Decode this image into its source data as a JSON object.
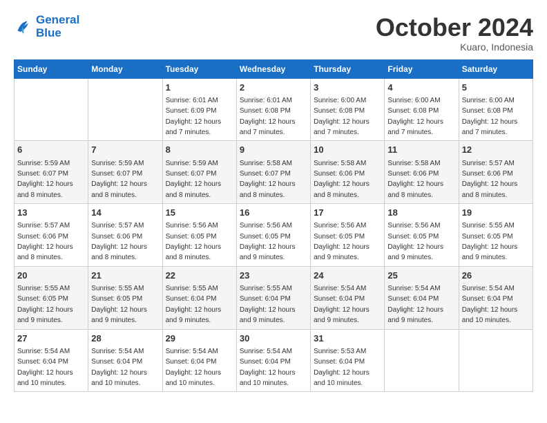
{
  "header": {
    "logo_line1": "General",
    "logo_line2": "Blue",
    "month": "October 2024",
    "location": "Kuaro, Indonesia"
  },
  "days_of_week": [
    "Sunday",
    "Monday",
    "Tuesday",
    "Wednesday",
    "Thursday",
    "Friday",
    "Saturday"
  ],
  "weeks": [
    [
      {
        "day": "",
        "sunrise": "",
        "sunset": "",
        "daylight": ""
      },
      {
        "day": "",
        "sunrise": "",
        "sunset": "",
        "daylight": ""
      },
      {
        "day": "1",
        "sunrise": "Sunrise: 6:01 AM",
        "sunset": "Sunset: 6:09 PM",
        "daylight": "Daylight: 12 hours and 7 minutes."
      },
      {
        "day": "2",
        "sunrise": "Sunrise: 6:01 AM",
        "sunset": "Sunset: 6:08 PM",
        "daylight": "Daylight: 12 hours and 7 minutes."
      },
      {
        "day": "3",
        "sunrise": "Sunrise: 6:00 AM",
        "sunset": "Sunset: 6:08 PM",
        "daylight": "Daylight: 12 hours and 7 minutes."
      },
      {
        "day": "4",
        "sunrise": "Sunrise: 6:00 AM",
        "sunset": "Sunset: 6:08 PM",
        "daylight": "Daylight: 12 hours and 7 minutes."
      },
      {
        "day": "5",
        "sunrise": "Sunrise: 6:00 AM",
        "sunset": "Sunset: 6:08 PM",
        "daylight": "Daylight: 12 hours and 7 minutes."
      }
    ],
    [
      {
        "day": "6",
        "sunrise": "Sunrise: 5:59 AM",
        "sunset": "Sunset: 6:07 PM",
        "daylight": "Daylight: 12 hours and 8 minutes."
      },
      {
        "day": "7",
        "sunrise": "Sunrise: 5:59 AM",
        "sunset": "Sunset: 6:07 PM",
        "daylight": "Daylight: 12 hours and 8 minutes."
      },
      {
        "day": "8",
        "sunrise": "Sunrise: 5:59 AM",
        "sunset": "Sunset: 6:07 PM",
        "daylight": "Daylight: 12 hours and 8 minutes."
      },
      {
        "day": "9",
        "sunrise": "Sunrise: 5:58 AM",
        "sunset": "Sunset: 6:07 PM",
        "daylight": "Daylight: 12 hours and 8 minutes."
      },
      {
        "day": "10",
        "sunrise": "Sunrise: 5:58 AM",
        "sunset": "Sunset: 6:06 PM",
        "daylight": "Daylight: 12 hours and 8 minutes."
      },
      {
        "day": "11",
        "sunrise": "Sunrise: 5:58 AM",
        "sunset": "Sunset: 6:06 PM",
        "daylight": "Daylight: 12 hours and 8 minutes."
      },
      {
        "day": "12",
        "sunrise": "Sunrise: 5:57 AM",
        "sunset": "Sunset: 6:06 PM",
        "daylight": "Daylight: 12 hours and 8 minutes."
      }
    ],
    [
      {
        "day": "13",
        "sunrise": "Sunrise: 5:57 AM",
        "sunset": "Sunset: 6:06 PM",
        "daylight": "Daylight: 12 hours and 8 minutes."
      },
      {
        "day": "14",
        "sunrise": "Sunrise: 5:57 AM",
        "sunset": "Sunset: 6:06 PM",
        "daylight": "Daylight: 12 hours and 8 minutes."
      },
      {
        "day": "15",
        "sunrise": "Sunrise: 5:56 AM",
        "sunset": "Sunset: 6:05 PM",
        "daylight": "Daylight: 12 hours and 8 minutes."
      },
      {
        "day": "16",
        "sunrise": "Sunrise: 5:56 AM",
        "sunset": "Sunset: 6:05 PM",
        "daylight": "Daylight: 12 hours and 9 minutes."
      },
      {
        "day": "17",
        "sunrise": "Sunrise: 5:56 AM",
        "sunset": "Sunset: 6:05 PM",
        "daylight": "Daylight: 12 hours and 9 minutes."
      },
      {
        "day": "18",
        "sunrise": "Sunrise: 5:56 AM",
        "sunset": "Sunset: 6:05 PM",
        "daylight": "Daylight: 12 hours and 9 minutes."
      },
      {
        "day": "19",
        "sunrise": "Sunrise: 5:55 AM",
        "sunset": "Sunset: 6:05 PM",
        "daylight": "Daylight: 12 hours and 9 minutes."
      }
    ],
    [
      {
        "day": "20",
        "sunrise": "Sunrise: 5:55 AM",
        "sunset": "Sunset: 6:05 PM",
        "daylight": "Daylight: 12 hours and 9 minutes."
      },
      {
        "day": "21",
        "sunrise": "Sunrise: 5:55 AM",
        "sunset": "Sunset: 6:05 PM",
        "daylight": "Daylight: 12 hours and 9 minutes."
      },
      {
        "day": "22",
        "sunrise": "Sunrise: 5:55 AM",
        "sunset": "Sunset: 6:04 PM",
        "daylight": "Daylight: 12 hours and 9 minutes."
      },
      {
        "day": "23",
        "sunrise": "Sunrise: 5:55 AM",
        "sunset": "Sunset: 6:04 PM",
        "daylight": "Daylight: 12 hours and 9 minutes."
      },
      {
        "day": "24",
        "sunrise": "Sunrise: 5:54 AM",
        "sunset": "Sunset: 6:04 PM",
        "daylight": "Daylight: 12 hours and 9 minutes."
      },
      {
        "day": "25",
        "sunrise": "Sunrise: 5:54 AM",
        "sunset": "Sunset: 6:04 PM",
        "daylight": "Daylight: 12 hours and 9 minutes."
      },
      {
        "day": "26",
        "sunrise": "Sunrise: 5:54 AM",
        "sunset": "Sunset: 6:04 PM",
        "daylight": "Daylight: 12 hours and 10 minutes."
      }
    ],
    [
      {
        "day": "27",
        "sunrise": "Sunrise: 5:54 AM",
        "sunset": "Sunset: 6:04 PM",
        "daylight": "Daylight: 12 hours and 10 minutes."
      },
      {
        "day": "28",
        "sunrise": "Sunrise: 5:54 AM",
        "sunset": "Sunset: 6:04 PM",
        "daylight": "Daylight: 12 hours and 10 minutes."
      },
      {
        "day": "29",
        "sunrise": "Sunrise: 5:54 AM",
        "sunset": "Sunset: 6:04 PM",
        "daylight": "Daylight: 12 hours and 10 minutes."
      },
      {
        "day": "30",
        "sunrise": "Sunrise: 5:54 AM",
        "sunset": "Sunset: 6:04 PM",
        "daylight": "Daylight: 12 hours and 10 minutes."
      },
      {
        "day": "31",
        "sunrise": "Sunrise: 5:53 AM",
        "sunset": "Sunset: 6:04 PM",
        "daylight": "Daylight: 12 hours and 10 minutes."
      },
      {
        "day": "",
        "sunrise": "",
        "sunset": "",
        "daylight": ""
      },
      {
        "day": "",
        "sunrise": "",
        "sunset": "",
        "daylight": ""
      }
    ]
  ]
}
